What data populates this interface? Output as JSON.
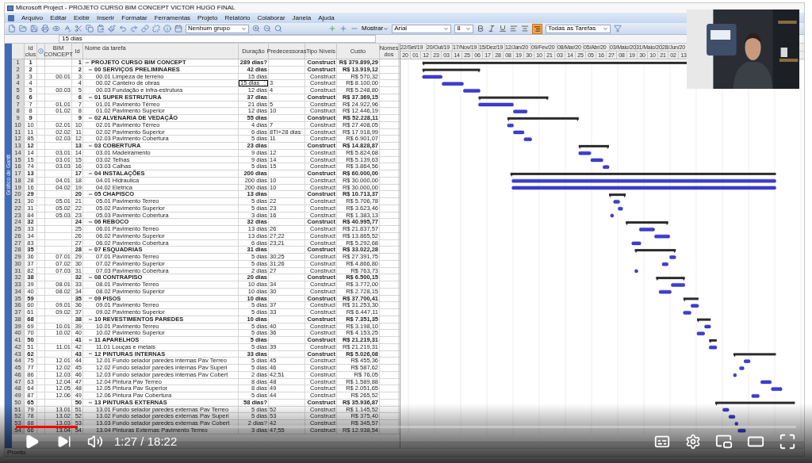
{
  "window": {
    "title": "Microsoft Project - PROJETO CURSO BIM CONCEPT VICTOR HUGO FINAL"
  },
  "menu": [
    "Arquivo",
    "Editar",
    "Exibir",
    "Inserir",
    "Formatar",
    "Ferramentas",
    "Projeto",
    "Relatório",
    "Colaborar",
    "Janela",
    "Ajuda"
  ],
  "toolbar": {
    "group": "Nenhum grupo",
    "show": "Mostrar",
    "font": "Arial",
    "size": "8",
    "filter": "Todas as Tarefas"
  },
  "entry_bar": {
    "value": "15 dias"
  },
  "side_label": "Gráfico de Gantt",
  "columns": [
    "Id clus",
    "BIM CONCEPT",
    "Id",
    "Nome da tarefa",
    "Duração",
    "Predecessoras",
    "Tipo Níveis",
    "Custo",
    "Nomes dos"
  ],
  "timescale": {
    "major": [
      "22/Set/19",
      "20/Out/19",
      "17/Nov/19",
      "15/Dez/19",
      "12/Jan/20",
      "09/Fev/20",
      "08/Mar/20",
      "05/Abr/20",
      "03/Maio/20",
      "31/Maio/20",
      "28/Jun/20"
    ],
    "minor": [
      "20",
      "01",
      "12",
      "23",
      "03",
      "14",
      "25",
      "06",
      "17",
      "28",
      "08",
      "19",
      "30",
      "10",
      "21",
      "03",
      "14",
      "25",
      "05",
      "16",
      "27",
      "08",
      "19",
      "30",
      "10",
      "21",
      "02",
      "13"
    ]
  },
  "tasks": [
    {
      "row": "1",
      "clus": "1",
      "id": "1",
      "name": "PROJETO CURSO BIM CONCEPT",
      "duration": "289 dias?",
      "type": "Construct",
      "cost": "R$ 379.899,29",
      "expanded": true,
      "children": [
        {
          "row": "2",
          "clus": "2",
          "id": "2",
          "name": "00 SERVIÇOS PRELIMINARES",
          "duration": "42 dias",
          "type": "Construct",
          "cost": "R$ 13.919,12",
          "expanded": true,
          "children": [
            {
              "row": "3",
              "clus": "3",
              "bim": "00.01",
              "id": "3",
              "name": "00.01 Limpeza de terreno",
              "duration": "15 dias",
              "type": "Construct",
              "cost": "R$ 570,32"
            },
            {
              "row": "4",
              "clus": "4",
              "id": "4",
              "name": "00.02 Canteiro de obras",
              "duration": "15 dias",
              "predecessors": "3",
              "type": "Construct",
              "cost": "R$ 8.100,00",
              "editing": true
            },
            {
              "row": "5",
              "clus": "5",
              "bim": "00.03",
              "id": "5",
              "name": "00.03 Fundação e infra-estrutura",
              "duration": "12 dias",
              "predecessors": "4",
              "type": "Construct",
              "cost": "R$ 5.248,80"
            }
          ]
        },
        {
          "row": "6",
          "clus": "6",
          "id": "6",
          "name": "01 SUPER ESTRUTURA",
          "duration": "37 dias",
          "type": "Construct",
          "cost": "R$ 37.369,15",
          "expanded": true,
          "children": [
            {
              "row": "7",
              "clus": "7",
              "bim": "01.01",
              "id": "7",
              "name": "01.01 Pavimento Térreo",
              "duration": "21 dias",
              "predecessors": "5",
              "type": "Construct",
              "cost": "R$ 24.922,96"
            },
            {
              "row": "8",
              "clus": "8",
              "bim": "01.02",
              "id": "8",
              "name": "01.02 Pavimento Superior",
              "duration": "12 dias",
              "predecessors": "10",
              "type": "Construct",
              "cost": "R$ 12.446,19"
            }
          ]
        },
        {
          "row": "9",
          "clus": "9",
          "id": "9",
          "name": "02 ALVENARIA DE VEDAÇÃO",
          "duration": "55 dias",
          "type": "Construct",
          "cost": "R$ 52.228,11",
          "expanded": true,
          "children": [
            {
              "row": "10",
              "clus": "10",
              "bim": "02.01",
              "id": "10",
              "name": "02.01 Pavimento Térreo",
              "duration": "4 dias",
              "predecessors": "7",
              "type": "Construct",
              "cost": "R$ 27.408,05"
            },
            {
              "row": "11",
              "clus": "11",
              "bim": "02.02",
              "id": "11",
              "name": "02.02 Pavimento Superior",
              "duration": "6 dias",
              "predecessors": "8TI+28 dias",
              "type": "Construct",
              "cost": "R$ 17.918,99"
            },
            {
              "row": "12",
              "clus": "85",
              "bim": "02.03",
              "id": "12",
              "name": "02.03 Pavimento Cobertura",
              "duration": "5 dias",
              "predecessors": "11",
              "type": "Construct",
              "cost": "R$ 6.901,07"
            }
          ]
        },
        {
          "row": "13",
          "clus": "12",
          "id": "13",
          "name": "03 COBERTURA",
          "duration": "23 dias",
          "type": "Construct",
          "cost": "R$ 14.828,87",
          "expanded": true,
          "children": [
            {
              "row": "14",
              "clus": "14",
              "bim": "03.01",
              "id": "14",
              "name": "03.01 Madeiramento",
              "duration": "9 dias",
              "predecessors": "12",
              "type": "Construct",
              "cost": "R$ 5.824,68"
            },
            {
              "row": "15",
              "clus": "15",
              "bim": "03.01",
              "id": "15",
              "name": "03.02 Telhas",
              "duration": "9 dias",
              "predecessors": "14",
              "type": "Construct",
              "cost": "R$ 5.139,63"
            },
            {
              "row": "16",
              "clus": "74",
              "bim": "03.03",
              "id": "16",
              "name": "03.03 Calhas",
              "duration": "5 dias",
              "predecessors": "15",
              "type": "Construct",
              "cost": "R$ 3.864,56"
            }
          ]
        },
        {
          "row": "17",
          "clus": "13",
          "id": "17",
          "name": "04 INSTALAÇÕES",
          "duration": "200 dias",
          "type": "Construct",
          "cost": "R$ 60.000,00",
          "expanded": true,
          "children": [
            {
              "row": "18",
              "clus": "28",
              "bim": "04.01",
              "id": "18",
              "name": "04.01 Hidraulica",
              "duration": "200 dias",
              "predecessors": "10",
              "type": "Construct",
              "cost": "R$ 30.000,00"
            },
            {
              "row": "19",
              "clus": "16",
              "bim": "04.02",
              "id": "19",
              "name": "04.02 Eletrica",
              "duration": "200 dias",
              "predecessors": "10",
              "type": "Construct",
              "cost": "R$ 30.000,00"
            }
          ]
        },
        {
          "row": "20",
          "clus": "29",
          "id": "20",
          "name": "05 CHAPISCO",
          "duration": "13 dias",
          "type": "Construct",
          "cost": "R$ 10.713,37",
          "expanded": true,
          "children": [
            {
              "row": "21",
              "clus": "30",
              "bim": "05.01",
              "id": "21",
              "name": "05.01 Pavimento Terreo",
              "duration": "5 dias",
              "predecessors": "22",
              "type": "Construct",
              "cost": "R$ 5.706,78"
            },
            {
              "row": "22",
              "clus": "31",
              "bim": "05.02",
              "id": "22",
              "name": "05.02 Pavimento Superior",
              "duration": "5 dias",
              "predecessors": "23",
              "type": "Construct",
              "cost": "R$ 3.623,46"
            },
            {
              "row": "23",
              "clus": "84",
              "bim": "05.03",
              "id": "23",
              "name": "05.03 Pavimento Cobertura",
              "duration": "3 dias",
              "predecessors": "16",
              "type": "Construct",
              "cost": "R$ 1.383,13"
            }
          ]
        },
        {
          "row": "24",
          "clus": "32",
          "id": "24",
          "name": "06 REBOCO",
          "duration": "32 dias",
          "type": "Construct",
          "cost": "R$ 40.995,77",
          "expanded": true,
          "children": [
            {
              "row": "25",
              "clus": "33",
              "id": "25",
              "name": "06.01 Pavimento Terreo",
              "duration": "13 dias",
              "predecessors": "26",
              "type": "Construct",
              "cost": "R$ 21.837,57"
            },
            {
              "row": "26",
              "clus": "34",
              "id": "26",
              "name": "06.02 Pavimento Superior",
              "duration": "13 dias",
              "predecessors": "27;22",
              "type": "Construct",
              "cost": "R$ 13.865,52"
            },
            {
              "row": "27",
              "clus": "83",
              "id": "27",
              "name": "06.02 Pavimento Cobertura",
              "duration": "6 dias",
              "predecessors": "23;21",
              "type": "Construct",
              "cost": "R$ 5.292,68"
            }
          ]
        },
        {
          "row": "28",
          "clus": "35",
          "id": "28",
          "name": "07 ESQUADRIAS",
          "duration": "31 dias",
          "type": "Construct",
          "cost": "R$ 33.022,28",
          "expanded": true,
          "children": [
            {
              "row": "29",
              "clus": "36",
              "bim": "07.01",
              "id": "29",
              "name": "07.01 Pavimento Terreo",
              "duration": "5 dias",
              "predecessors": "30;25",
              "type": "Construct",
              "cost": "R$ 27.391,75"
            },
            {
              "row": "30",
              "clus": "37",
              "bim": "07.02",
              "id": "30",
              "name": "07.02 Pavimento Superior",
              "duration": "5 dias",
              "predecessors": "31;26",
              "type": "Construct",
              "cost": "R$ 4.866,80"
            },
            {
              "row": "31",
              "clus": "82",
              "bim": "07.03",
              "id": "31",
              "name": "07.03 Pavimento Cobertura",
              "duration": "2 dias",
              "predecessors": "27",
              "type": "Construct",
              "cost": "R$ 763,73"
            }
          ]
        },
        {
          "row": "32",
          "clus": "38",
          "id": "32",
          "name": "08 CONTRAPISO",
          "duration": "20 dias",
          "type": "Construct",
          "cost": "R$ 6.500,15",
          "expanded": true,
          "children": [
            {
              "row": "33",
              "clus": "39",
              "bim": "08.01",
              "id": "33",
              "name": "08.01 Pavimento Terreo",
              "duration": "10 dias",
              "predecessors": "34",
              "type": "Construct",
              "cost": "R$ 3.772,00"
            },
            {
              "row": "34",
              "clus": "40",
              "bim": "08.02",
              "id": "34",
              "name": "08.02 Pavimento Superior",
              "duration": "10 dias",
              "predecessors": "30",
              "type": "Construct",
              "cost": "R$ 2.728,15"
            }
          ]
        },
        {
          "row": "35",
          "clus": "59",
          "id": "35",
          "name": "09 PISOS",
          "duration": "10 dias",
          "type": "Construct",
          "cost": "R$ 37.700,41",
          "expanded": true,
          "children": [
            {
              "row": "36",
              "clus": "60",
              "bim": "09.01",
              "id": "36",
              "name": "09.01 Pavimento Terreo",
              "duration": "5 dias",
              "predecessors": "37",
              "type": "Construct",
              "cost": "R$ 31.253,30"
            },
            {
              "row": "37",
              "clus": "61",
              "bim": "09.02",
              "id": "37",
              "name": "09.02 Pavimento Superior",
              "duration": "5 dias",
              "predecessors": "33",
              "type": "Construct",
              "cost": "R$ 6.447,11"
            }
          ]
        },
        {
          "row": "38",
          "clus": "68",
          "id": "38",
          "name": "10 REVESTIMENTOS PAREDES",
          "duration": "10 dias",
          "type": "Construct",
          "cost": "R$ 7.351,35",
          "expanded": true,
          "children": [
            {
              "row": "39",
              "clus": "69",
              "bim": "10.01",
              "id": "39",
              "name": "10.01 Pavimento Terreo",
              "duration": "5 dias",
              "predecessors": "40",
              "type": "Construct",
              "cost": "R$ 3.198,10"
            },
            {
              "row": "40",
              "clus": "70",
              "bim": "10.02",
              "id": "40",
              "name": "10.02 Pavimento Superior",
              "duration": "5 dias",
              "predecessors": "36",
              "type": "Construct",
              "cost": "R$ 4.153,25"
            }
          ]
        },
        {
          "row": "41",
          "clus": "50",
          "id": "41",
          "name": "11 APARELHOS",
          "duration": "5 dias",
          "type": "Construct",
          "cost": "R$ 21.219,31",
          "expanded": true,
          "children": [
            {
              "row": "42",
              "clus": "51",
              "bim": "11.01",
              "id": "42",
              "name": "11.01 Louças e metais",
              "duration": "5 dias",
              "predecessors": "39",
              "type": "Construct",
              "cost": "R$ 21.219,31"
            }
          ]
        },
        {
          "row": "43",
          "clus": "62",
          "id": "43",
          "name": "12 PINTURAS INTERNAS",
          "duration": "33 dias",
          "type": "Construct",
          "cost": "R$ 5.026,08",
          "expanded": true,
          "children": [
            {
              "row": "44",
              "clus": "75",
              "bim": "12.01",
              "id": "44",
              "name": "12.01 Fundo selador paredes internas Pav Terreo",
              "duration": "5 dias",
              "predecessors": "45",
              "type": "Construct",
              "cost": "R$ 455,36"
            },
            {
              "row": "45",
              "clus": "77",
              "bim": "12.02",
              "id": "45",
              "name": "12.02 Fundo selador paredes internas  Pav Superi",
              "duration": "5 dias",
              "predecessors": "46",
              "type": "Construct",
              "cost": "R$ 587,62"
            },
            {
              "row": "46",
              "clus": "86",
              "bim": "12.03",
              "id": "46",
              "name": "12.03 Fundo selador paredes internas  Pav Cobert",
              "duration": "2 dias",
              "predecessors": "42;51",
              "type": "Construct",
              "cost": "R$ 76,05"
            },
            {
              "row": "47",
              "clus": "63",
              "bim": "12.04",
              "id": "47",
              "name": "12.04 Pintura Pav Terreo",
              "duration": "8 dias",
              "predecessors": "48",
              "type": "Construct",
              "cost": "R$ 1.589,88"
            },
            {
              "row": "48",
              "clus": "64",
              "bim": "12.05",
              "id": "48",
              "name": "12.05 Pintura Pav Superior",
              "duration": "8 dias",
              "predecessors": "49",
              "type": "Construct",
              "cost": "R$ 2.051,65"
            },
            {
              "row": "49",
              "clus": "87",
              "bim": "12.06",
              "id": "49",
              "name": "12.06 Pintura Pav Cobertura",
              "duration": "5 dias",
              "predecessors": "44",
              "type": "Construct",
              "cost": "R$ 265,52"
            }
          ]
        },
        {
          "row": "50",
          "clus": "65",
          "id": "50",
          "name": "13 PINTURAS EXTERNAS",
          "duration": "58 dias?",
          "type": "Construct",
          "cost": "R$ 35.936,87",
          "expanded": true,
          "children": [
            {
              "row": "51",
              "clus": "79",
              "bim": "13.01",
              "id": "51",
              "name": "13.01 Fundo selador paredes externas Pav Terreo",
              "duration": "5 dias",
              "predecessors": "52",
              "type": "Construct",
              "cost": "R$ 1.145,52"
            },
            {
              "row": "52",
              "clus": "78",
              "bim": "13.02",
              "id": "52",
              "name": "13.02 Fundo selador paredes externas Pav Superi",
              "duration": "5 dias",
              "predecessors": "53",
              "type": "Construct",
              "cost": "R$ 375,40"
            },
            {
              "row": "53",
              "clus": "88",
              "bim": "13.03",
              "id": "53",
              "name": "13.03 Fundo selador paredes externas Pav Cobert",
              "duration": "2 dias?",
              "predecessors": "42",
              "type": "Construct",
              "cost": "R$ 345,57"
            },
            {
              "row": "54",
              "clus": "66",
              "bim": "13.04",
              "id": "54",
              "name": "13.04 Pinturas Externas Pavimento Terreo",
              "duration": "3 dias",
              "predecessors": "47;55",
              "type": "Construct",
              "cost": "R$ 12.938,54"
            }
          ]
        }
      ]
    }
  ],
  "status_bar": "Pronto",
  "player": {
    "time": "1:27 / 18:22",
    "progress": {
      "level": 0.079
    }
  }
}
